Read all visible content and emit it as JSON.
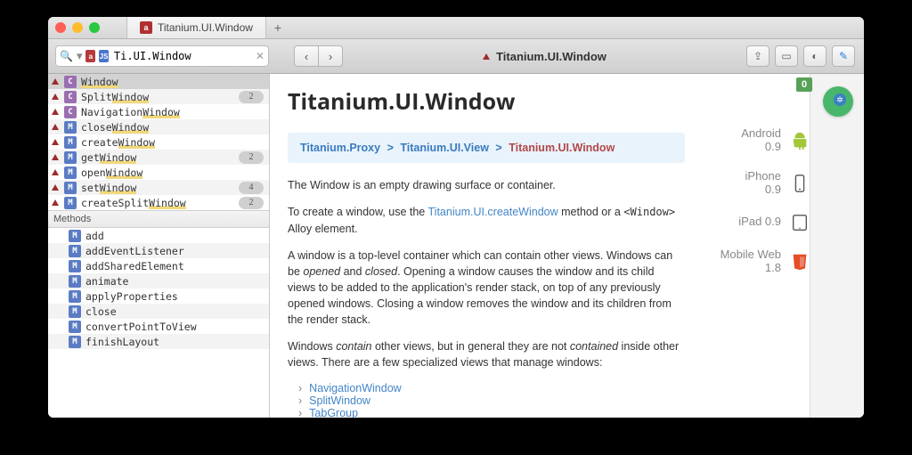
{
  "window": {
    "tab_title": "Titanium.UI.Window"
  },
  "search": {
    "value": "Ti.UI.Window"
  },
  "toolbar_title": "Titanium.UI.Window",
  "symbols": [
    {
      "kind": "C",
      "name_pre": "",
      "name_hl": "Window",
      "name_post": "",
      "count": "",
      "alt": false,
      "sel": true
    },
    {
      "kind": "C",
      "name_pre": "Split",
      "name_hl": "Window",
      "name_post": "",
      "count": "2",
      "alt": true,
      "sel": false
    },
    {
      "kind": "C",
      "name_pre": "Navigation",
      "name_hl": "Window",
      "name_post": "",
      "count": "",
      "alt": false,
      "sel": false
    },
    {
      "kind": "M",
      "name_pre": "close",
      "name_hl": "Window",
      "name_post": "",
      "count": "",
      "alt": true,
      "sel": false
    },
    {
      "kind": "M",
      "name_pre": "create",
      "name_hl": "Window",
      "name_post": "",
      "count": "",
      "alt": false,
      "sel": false
    },
    {
      "kind": "M",
      "name_pre": "get",
      "name_hl": "Window",
      "name_post": "",
      "count": "2",
      "alt": true,
      "sel": false
    },
    {
      "kind": "M",
      "name_pre": "open",
      "name_hl": "Window",
      "name_post": "",
      "count": "",
      "alt": false,
      "sel": false
    },
    {
      "kind": "M",
      "name_pre": "set",
      "name_hl": "Window",
      "name_post": "",
      "count": "4",
      "alt": true,
      "sel": false
    },
    {
      "kind": "M",
      "name_pre": "createSplit",
      "name_hl": "Window",
      "name_post": "",
      "count": "2",
      "alt": false,
      "sel": false
    }
  ],
  "methods_header": "Methods",
  "methods": [
    {
      "name": "add",
      "alt": false
    },
    {
      "name": "addEventListener",
      "alt": true
    },
    {
      "name": "addSharedElement",
      "alt": false
    },
    {
      "name": "animate",
      "alt": true
    },
    {
      "name": "applyProperties",
      "alt": false
    },
    {
      "name": "close",
      "alt": true
    },
    {
      "name": "convertPointToView",
      "alt": false
    },
    {
      "name": "finishLayout",
      "alt": true
    }
  ],
  "page": {
    "title": "Titanium.UI.Window",
    "crumb1": "Titanium.Proxy",
    "crumb2": "Titanium.UI.View",
    "crumb3": "Titanium.UI.Window",
    "p1": "The Window is an empty drawing surface or container.",
    "p2a": "To create a window, use the ",
    "p2link": "Titanium.UI.createWindow",
    "p2b": " method or a ",
    "p2code": "<Window>",
    "p2c": " Alloy element.",
    "p3": "A window is a top-level container which can contain other views. Windows can be opened and closed. Opening a window causes the window and its child views to be added to the application's render stack, on top of any previously opened windows. Closing a window removes the window and its children from the render stack.",
    "p4": "Windows contain other views, but in general they are not contained inside other views. There are a few specialized views that manage windows:",
    "links": [
      "NavigationWindow",
      "SplitWindow",
      "TabGroup"
    ]
  },
  "platforms": [
    {
      "name": "Android",
      "ver": "0.9",
      "icon": "android"
    },
    {
      "name": "iPhone",
      "ver": "0.9",
      "icon": "iphone"
    },
    {
      "name": "iPad",
      "ver": "0.9",
      "icon": "ipad",
      "oneline": true
    },
    {
      "name": "Mobile Web",
      "ver": "1.8",
      "icon": "html5"
    }
  ],
  "rail": {
    "zero": "0"
  }
}
